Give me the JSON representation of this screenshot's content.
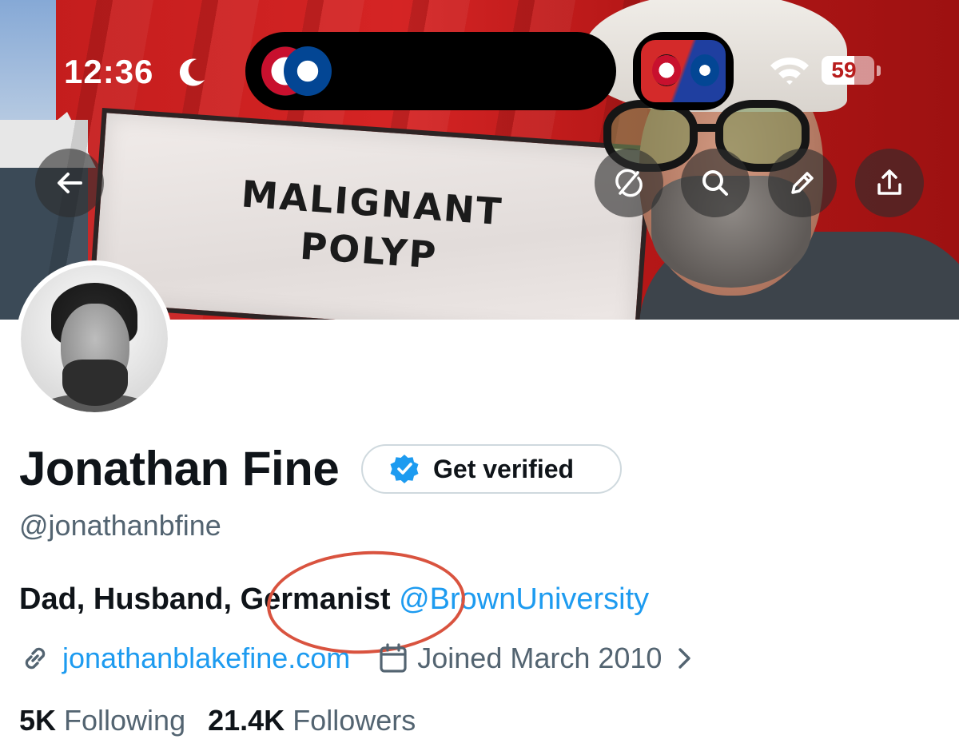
{
  "status_bar": {
    "time": "12:36",
    "battery_level": "59",
    "dnd_icon": "moon-icon",
    "wifi_icon": "wifi-icon"
  },
  "banner": {
    "sign_lines": [
      "MALIGNANT",
      "POLYP"
    ],
    "live_activity": {
      "home_team_icon": "wrexham-crest-icon",
      "away_team_icon": "chelsea-crest-icon"
    }
  },
  "banner_actions": [
    {
      "icon": "back-arrow-icon"
    },
    {
      "icon": "sync-icon"
    },
    {
      "icon": "search-icon"
    },
    {
      "icon": "pencil-icon"
    },
    {
      "icon": "share-icon"
    }
  ],
  "profile": {
    "name": "Jonathan Fine",
    "get_verified_label": "Get verified",
    "handle": "@jonathanbfine",
    "bio_text": "Dad, Husband, Germanist ",
    "bio_mention": "@BrownUniversity",
    "website": "jonathanblakefine.com",
    "joined": "Joined March 2010",
    "following_count": "5K",
    "following_label": "Following",
    "followers_count": "21.4K",
    "followers_label": "Followers"
  },
  "colors": {
    "accent": "#1d9bf0",
    "secondary_text": "#536471",
    "annotation_circle": "#d9533f"
  }
}
